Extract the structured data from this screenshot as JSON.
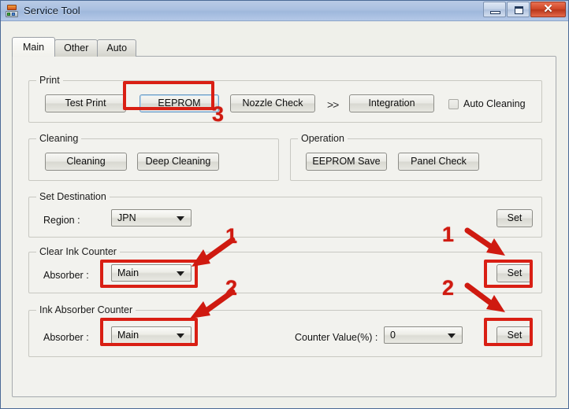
{
  "window": {
    "title": "Service Tool",
    "app_icon": "service-tool-icon",
    "minimize_label": "Minimize",
    "maximize_label": "Maximize",
    "close_label": "✕"
  },
  "tabs": [
    {
      "label": "Main",
      "selected": true
    },
    {
      "label": "Other",
      "selected": false
    },
    {
      "label": "Auto",
      "selected": false
    }
  ],
  "groups": {
    "print": {
      "title": "Print",
      "buttons": [
        {
          "label": "Test Print"
        },
        {
          "label": "EEPROM"
        },
        {
          "label": "Nozzle Check"
        },
        {
          "label": "Integration"
        }
      ],
      "separator": ">>",
      "checkbox": {
        "label": "Auto Cleaning",
        "checked": false
      }
    },
    "cleaning": {
      "title": "Cleaning",
      "buttons": [
        {
          "label": "Cleaning"
        },
        {
          "label": "Deep Cleaning"
        }
      ]
    },
    "operation": {
      "title": "Operation",
      "buttons": [
        {
          "label": "EEPROM Save"
        },
        {
          "label": "Panel Check"
        }
      ]
    },
    "set_destination": {
      "title": "Set Destination",
      "region_label": "Region :",
      "region_value": "JPN",
      "set_label": "Set"
    },
    "clear_ink_counter": {
      "title": "Clear Ink Counter",
      "absorber_label": "Absorber :",
      "absorber_value": "Main",
      "set_label": "Set"
    },
    "ink_absorber_counter": {
      "title": "Ink Absorber Counter",
      "absorber_label": "Absorber :",
      "absorber_value": "Main",
      "counter_label": "Counter Value(%) :",
      "counter_value": "0",
      "set_label": "Set"
    }
  },
  "annotations": {
    "color": "#d91f14",
    "steps": [
      {
        "number": "1",
        "target": "clear-ink-counter-absorber"
      },
      {
        "number": "1",
        "target": "set-destination-set-button"
      },
      {
        "number": "2",
        "target": "ink-absorber-counter-absorber"
      },
      {
        "number": "2",
        "target": "clear-ink-counter-set-button"
      },
      {
        "number": "3",
        "target": "eeprom-button"
      }
    ],
    "n1a": "1",
    "n1b": "1",
    "n2a": "2",
    "n2b": "2",
    "n3": "3"
  }
}
